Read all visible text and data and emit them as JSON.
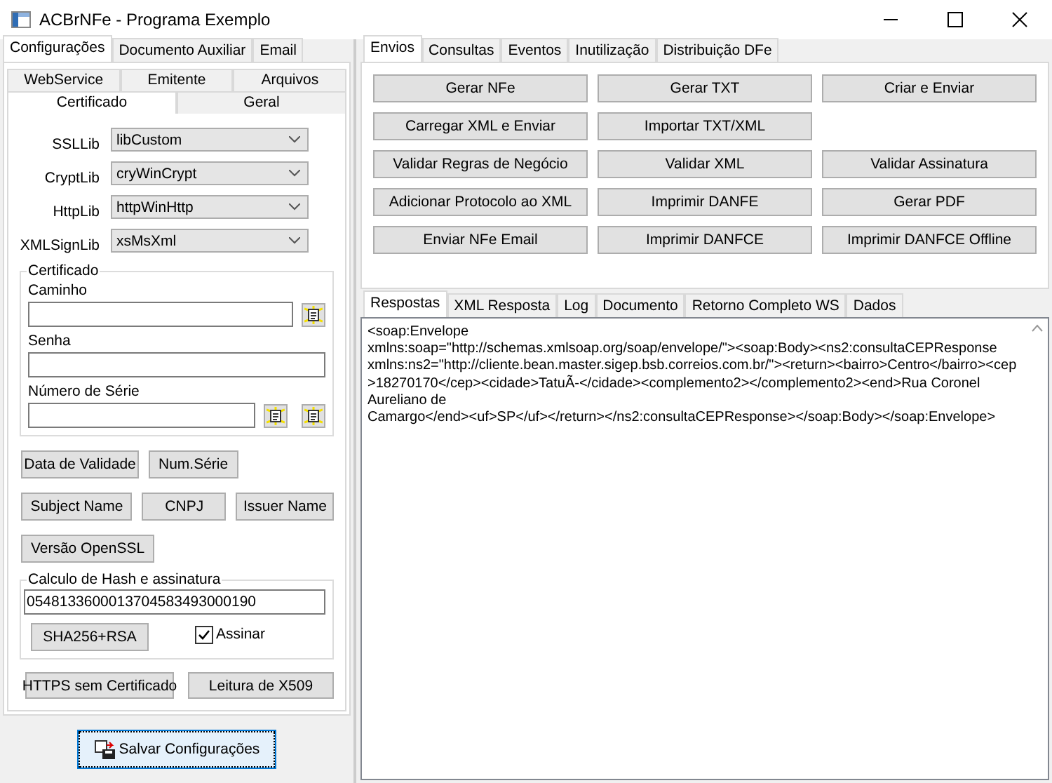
{
  "window": {
    "title": "ACBrNFe - Programa Exemplo"
  },
  "left": {
    "tabs": [
      {
        "label": "Configurações",
        "selected": true
      },
      {
        "label": "Documento Auxiliar",
        "selected": false
      },
      {
        "label": "Email",
        "selected": false
      }
    ],
    "subtabs_top": [
      {
        "label": "WebService",
        "selected": false
      },
      {
        "label": "Emitente",
        "selected": false
      },
      {
        "label": "Arquivos",
        "selected": false
      }
    ],
    "subtabs_bottom": [
      {
        "label": "Certificado",
        "selected": true
      },
      {
        "label": "Geral",
        "selected": false
      }
    ],
    "libs": [
      {
        "label": "SSLLib",
        "value": "libCustom"
      },
      {
        "label": "CryptLib",
        "value": "cryWinCrypt"
      },
      {
        "label": "HttpLib",
        "value": "httpWinHttp"
      },
      {
        "label": "XMLSignLib",
        "value": "xsMsXml"
      }
    ],
    "certificado": {
      "title": "Certificado",
      "caminho_label": "Caminho",
      "senha_label": "Senha",
      "serie_label": "Número de Série"
    },
    "cert_buttons": [
      [
        "Data de Validade",
        "Num.Série"
      ],
      [
        "Subject Name",
        "CNPJ",
        "Issuer Name"
      ],
      [
        "Versão OpenSSL"
      ]
    ],
    "hash": {
      "title": "Calculo de Hash e assinatura",
      "value": "0548133600013704583493000190",
      "button": "SHA256+RSA",
      "checkbox": {
        "label": "Assinar",
        "checked": true
      }
    },
    "bottom_buttons": [
      "HTTPS sem Certificado",
      "Leitura de X509"
    ],
    "save_button": "Salvar Configurações"
  },
  "right": {
    "tabs": [
      {
        "label": "Envios",
        "selected": true
      },
      {
        "label": "Consultas",
        "selected": false
      },
      {
        "label": "Eventos",
        "selected": false
      },
      {
        "label": "Inutilização",
        "selected": false
      },
      {
        "label": "Distribuição DFe",
        "selected": false
      }
    ],
    "buttons": [
      [
        "Gerar NFe",
        "Gerar TXT",
        "Criar e Enviar"
      ],
      [
        "Carregar XML e Enviar",
        "Importar TXT/XML"
      ],
      [
        "Validar Regras de Negócio",
        "Validar XML",
        "Validar Assinatura"
      ],
      [
        "Adicionar Protocolo ao XML",
        "Imprimir DANFE",
        "Gerar PDF"
      ],
      [
        "Enviar NFe Email",
        "Imprimir DANFCE",
        "Imprimir DANFCE Offline"
      ]
    ],
    "output_tabs": [
      {
        "label": "Respostas",
        "selected": true
      },
      {
        "label": "XML Resposta",
        "selected": false
      },
      {
        "label": "Log",
        "selected": false
      },
      {
        "label": "Documento",
        "selected": false
      },
      {
        "label": "Retorno Completo WS",
        "selected": false
      },
      {
        "label": "Dados",
        "selected": false
      }
    ],
    "response_lines": [
      "<soap:Envelope",
      "xmlns:soap=\"http://schemas.xmlsoap.org/soap/envelope/\"><soap:Body><ns2:consultaCEPResponse",
      "xmlns:ns2=\"http://cliente.bean.master.sigep.bsb.correios.com.br/\"><return><bairro>Centro</bairro><cep",
      ">18270170</cep><cidade>TatuÃ-</cidade><complemento2></complemento2><end>Rua Coronel",
      "Aureliano de",
      "Camargo</end><uf>SP</uf></return></ns2:consultaCEPResponse></soap:Body></soap:Envelope>"
    ]
  }
}
